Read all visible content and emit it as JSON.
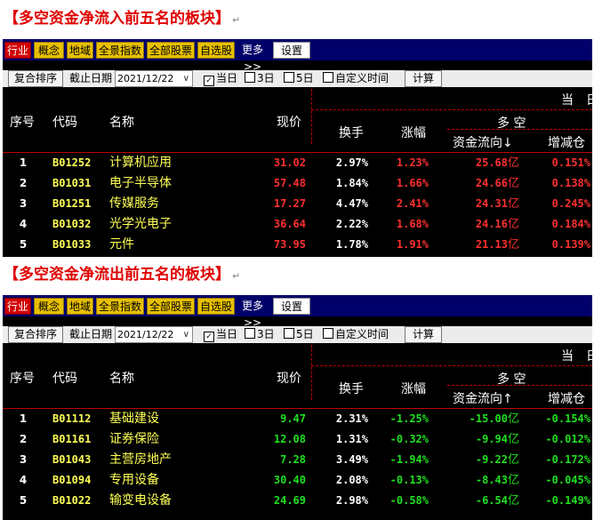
{
  "sections": [
    {
      "title": "【多空资金净流入前五名的板块】",
      "mark": "↵",
      "tabs": [
        "行业",
        "概念",
        "地域",
        "全景指数",
        "全部股票",
        "自选股"
      ],
      "more": "更多>>",
      "setting": "设置",
      "toolbar": {
        "sort_button": "复合排序",
        "date_label": "截止日期",
        "date_value": "2021/12/22",
        "opt_today": "当日",
        "opt_3day": "3日",
        "opt_5day": "5日",
        "opt_custom": "自定义时间",
        "calc_button": "计算"
      },
      "headers": {
        "seq": "序号",
        "code": "代码",
        "name": "名称",
        "price": "现价",
        "turnover": "换手",
        "change": "涨幅",
        "dang": "当",
        "ri": "日",
        "duokong": "多 空",
        "flow": "资金流向↓",
        "pos_change": "增减仓"
      },
      "rows": [
        {
          "seq": "1",
          "code": "B01252",
          "name": "计算机应用",
          "price": "31.02",
          "turnover": "2.97%",
          "change": "1.23%",
          "flow": "25.68",
          "unit": "亿",
          "pos_change": "0.151%"
        },
        {
          "seq": "2",
          "code": "B01031",
          "name": "电子半导体",
          "price": "57.48",
          "turnover": "1.84%",
          "change": "1.66%",
          "flow": "24.66",
          "unit": "亿",
          "pos_change": "0.138%"
        },
        {
          "seq": "3",
          "code": "B01251",
          "name": "传媒服务",
          "price": "17.27",
          "turnover": "4.47%",
          "change": "2.41%",
          "flow": "24.31",
          "unit": "亿",
          "pos_change": "0.245%"
        },
        {
          "seq": "4",
          "code": "B01032",
          "name": "光学光电子",
          "price": "36.64",
          "turnover": "2.22%",
          "change": "1.68%",
          "flow": "24.16",
          "unit": "亿",
          "pos_change": "0.184%"
        },
        {
          "seq": "5",
          "code": "B01033",
          "name": "元件",
          "price": "73.95",
          "turnover": "1.78%",
          "change": "1.91%",
          "flow": "21.13",
          "unit": "亿",
          "pos_change": "0.139%"
        }
      ]
    },
    {
      "title": "【多空资金净流出前五名的板块】",
      "mark": "↵",
      "tabs": [
        "行业",
        "概念",
        "地域",
        "全景指数",
        "全部股票",
        "自选股"
      ],
      "more": "更多>>",
      "setting": "设置",
      "toolbar": {
        "sort_button": "复合排序",
        "date_label": "截止日期",
        "date_value": "2021/12/22",
        "opt_today": "当日",
        "opt_3day": "3日",
        "opt_5day": "5日",
        "opt_custom": "自定义时间",
        "calc_button": "计算"
      },
      "headers": {
        "seq": "序号",
        "code": "代码",
        "name": "名称",
        "price": "现价",
        "turnover": "换手",
        "change": "涨幅",
        "dang": "当",
        "ri": "日",
        "duokong": "多 空",
        "flow": "资金流向↑",
        "pos_change": "增减仓"
      },
      "rows": [
        {
          "seq": "1",
          "code": "B01112",
          "name": "基础建设",
          "price": "9.47",
          "turnover": "2.31%",
          "change": "-1.25%",
          "flow": "-15.00",
          "unit": "亿",
          "pos_change": "-0.154%"
        },
        {
          "seq": "2",
          "code": "B01161",
          "name": "证券保险",
          "price": "12.08",
          "turnover": "1.31%",
          "change": "-0.32%",
          "flow": "-9.94",
          "unit": "亿",
          "pos_change": "-0.012%"
        },
        {
          "seq": "3",
          "code": "B01043",
          "name": "主营房地产",
          "price": "7.28",
          "turnover": "3.49%",
          "change": "-1.94%",
          "flow": "-9.22",
          "unit": "亿",
          "pos_change": "-0.172%"
        },
        {
          "seq": "4",
          "code": "B01094",
          "name": "专用设备",
          "price": "30.40",
          "turnover": "2.08%",
          "change": "-0.13%",
          "flow": "-8.43",
          "unit": "亿",
          "pos_change": "-0.045%"
        },
        {
          "seq": "5",
          "code": "B01022",
          "name": "输变电设备",
          "price": "24.69",
          "turnover": "2.98%",
          "change": "-0.58%",
          "flow": "-6.54",
          "unit": "亿",
          "pos_change": "-0.149%"
        }
      ]
    }
  ],
  "colors": {
    "up": "#ff3030",
    "down": "#20e020",
    "code": "#ffff55",
    "tab": "#e8c000",
    "tab_active": "#d00000",
    "tabbar": "#00006a",
    "title": "#e00000",
    "divider": "#c00000"
  }
}
